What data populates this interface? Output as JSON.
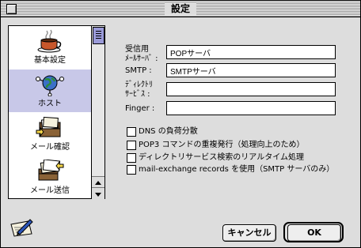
{
  "window": {
    "title": "設定"
  },
  "sidebar": {
    "items": [
      {
        "label": "基本設定",
        "icon": "coffee-cup-icon",
        "selected": false
      },
      {
        "label": "ホスト",
        "icon": "globe-network-icon",
        "selected": true
      },
      {
        "label": "メール確認",
        "icon": "mail-check-icon",
        "selected": false
      },
      {
        "label": "メール送信",
        "icon": "mail-send-icon",
        "selected": false
      }
    ]
  },
  "form": {
    "pop_label_1": "受信用",
    "pop_label_2": "ﾒｰﾙｻｰﾊﾞ :",
    "pop_value": "POPサーバ",
    "smtp_label": "SMTP :",
    "smtp_value": "SMTPサーバ",
    "dir_label_1": "ﾃﾞｨﾚｸﾄﾘ",
    "dir_label_2": "ｻｰﾋﾞｽ :",
    "dir_value": "",
    "finger_label": "Finger :",
    "finger_value": ""
  },
  "options": [
    {
      "label": "DNS の負荷分散",
      "checked": false
    },
    {
      "label": "POP3 コマンドの重複発行（処理向上のため）",
      "checked": false
    },
    {
      "label": "ディレクトリサービス検索のリアルタイム処理",
      "checked": false
    },
    {
      "label": "mail-exchange records を使用（SMTP サーバのみ）",
      "checked": false
    }
  ],
  "buttons": {
    "cancel": "キャンセル",
    "ok": "OK"
  },
  "bottom_icon": "pen-paper-icon",
  "colors": {
    "selection": "#c8c8e8",
    "scroll_thumb": "#9a9ad8",
    "window_bg": "#dddddd"
  }
}
